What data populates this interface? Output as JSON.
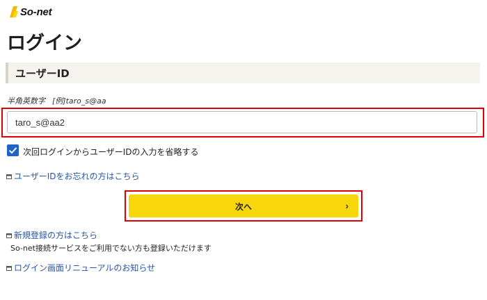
{
  "brand": {
    "name": "So-net",
    "logo_colors": [
      "#f3b800",
      "#f7d70c"
    ]
  },
  "page_title": "ログイン",
  "section": {
    "title": "ユーザーID"
  },
  "form": {
    "hint_label": "半角英数字",
    "hint_example": "[例]taro_s@aa",
    "user_id_value": "taro_s@aa2",
    "remember_label": "次回ログインからユーザーIDの入力を省略する",
    "remember_checked": true,
    "next_button_label": "次へ",
    "next_button_chevron": "›"
  },
  "links": {
    "forgot_id": "ユーザーIDをお忘れの方はこちら",
    "register": "新規登録の方はこちら",
    "register_note": "So-net接続サービスをご利用でない方も登録いただけます",
    "renewal_notice": "ログイン画面リニューアルのお知らせ"
  },
  "colors": {
    "accent_yellow": "#f7d70c",
    "highlight_red": "#e00000",
    "checkbox_blue": "#1e63c7",
    "link_blue": "#2a55a8",
    "section_bg": "#f4f3ee"
  },
  "icons": {
    "logo": "so-net-logo-icon",
    "link": "new-window-icon",
    "check": "check-icon",
    "chevron": "chevron-right-icon"
  }
}
